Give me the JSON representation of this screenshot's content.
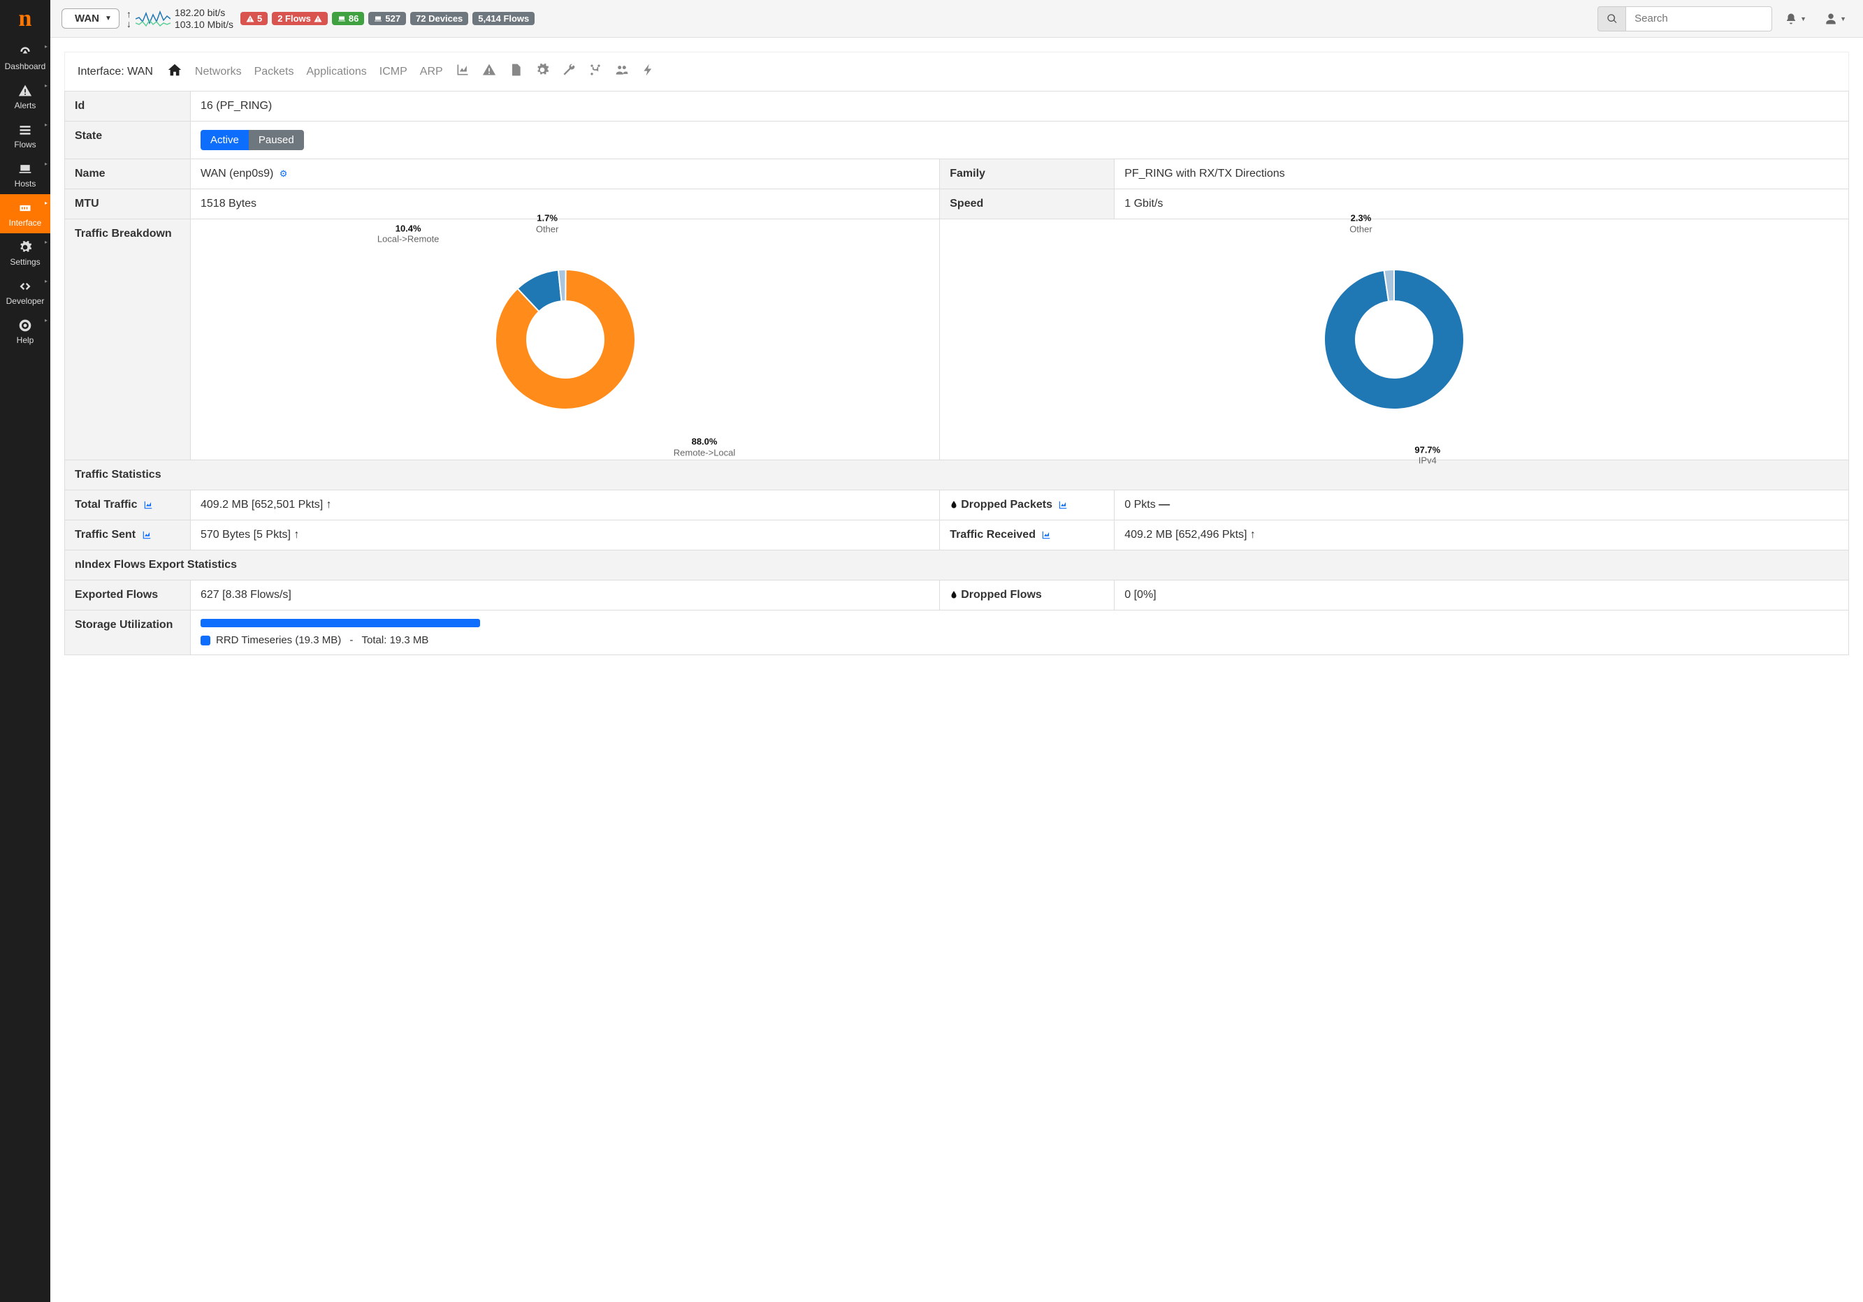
{
  "sidebar": {
    "items": [
      {
        "label": "Dashboard",
        "icon": "gauge"
      },
      {
        "label": "Alerts",
        "icon": "warning"
      },
      {
        "label": "Flows",
        "icon": "bars"
      },
      {
        "label": "Hosts",
        "icon": "laptop"
      },
      {
        "label": "Interface",
        "icon": "ethernet",
        "active": true
      },
      {
        "label": "Settings",
        "icon": "gear"
      },
      {
        "label": "Developer",
        "icon": "code"
      },
      {
        "label": "Help",
        "icon": "lifebuoy"
      }
    ]
  },
  "topbar": {
    "interface_selector": "WAN",
    "speed_up": "182.20 bit/s",
    "speed_down": "103.10 Mbit/s",
    "badges": [
      {
        "text": "5",
        "style": "red",
        "icon": "warning"
      },
      {
        "text": "2 Flows",
        "style": "red",
        "icon": "warning-right"
      },
      {
        "text": "86",
        "style": "green",
        "icon": "laptop"
      },
      {
        "text": "527",
        "style": "gray",
        "icon": "laptop"
      },
      {
        "text": "72 Devices",
        "style": "gray"
      },
      {
        "text": "5,414 Flows",
        "style": "gray"
      }
    ],
    "search_placeholder": "Search"
  },
  "panel": {
    "title": "Interface: WAN",
    "tabs": [
      "Networks",
      "Packets",
      "Applications",
      "ICMP",
      "ARP"
    ]
  },
  "info": {
    "id": "16 (PF_RING)",
    "state_active": "Active",
    "state_paused": "Paused",
    "name": "WAN (enp0s9)",
    "family_label": "Family",
    "family_value": "PF_RING with RX/TX Directions",
    "mtu_label": "MTU",
    "mtu_value": "1518 Bytes",
    "speed_label": "Speed",
    "speed_value": "1 Gbit/s",
    "traffic_breakdown_label": "Traffic Breakdown",
    "row_labels": {
      "id": "Id",
      "state": "State",
      "name": "Name"
    }
  },
  "chart_data": [
    {
      "type": "pie",
      "title": "Traffic Direction",
      "series": [
        {
          "name": "Remote->Local",
          "value": 88.0,
          "color": "#ff8c1a"
        },
        {
          "name": "Local->Remote",
          "value": 10.4,
          "color": "#1f77b4"
        },
        {
          "name": "Other",
          "value": 1.7,
          "color": "#a9c5de"
        }
      ]
    },
    {
      "type": "pie",
      "title": "Traffic Protocol",
      "series": [
        {
          "name": "IPv4",
          "value": 97.7,
          "color": "#1f77b4"
        },
        {
          "name": "Other",
          "value": 2.3,
          "color": "#a9c5de"
        }
      ]
    }
  ],
  "stats": {
    "traffic_header": "Traffic Statistics",
    "total_traffic_label": "Total Traffic",
    "total_traffic_value": "409.2 MB [652,501 Pkts]",
    "dropped_pkts_label": "Dropped Packets",
    "dropped_pkts_value": "0 Pkts",
    "sent_label": "Traffic Sent",
    "sent_value": "570 Bytes [5 Pkts]",
    "recv_label": "Traffic Received",
    "recv_value": "409.2 MB [652,496 Pkts]",
    "nindex_header": "nIndex Flows Export Statistics",
    "exported_label": "Exported Flows",
    "exported_value": "627 [8.38 Flows/s]",
    "dropped_flows_label": "Dropped Flows",
    "dropped_flows_value": "0 [0%]",
    "storage_label": "Storage Utilization",
    "storage_legend": "RRD Timeseries (19.3 MB)",
    "storage_total": "Total: 19.3 MB",
    "storage_pct": 100
  }
}
